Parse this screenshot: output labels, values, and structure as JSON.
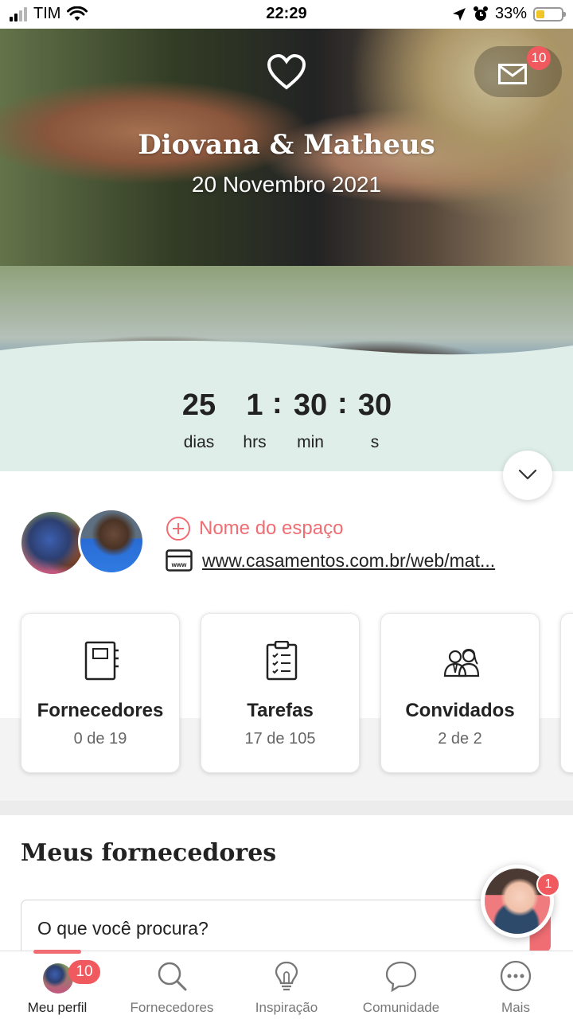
{
  "status_bar": {
    "carrier": "TIM",
    "time": "22:29",
    "battery_percent": "33%",
    "battery_level": 0.33
  },
  "hero": {
    "couple_names": "Diovana & Matheus",
    "wedding_date": "20 Novembro 2021",
    "messages_badge": "10",
    "countdown": {
      "days": "25",
      "days_label": "dias",
      "hours": "1",
      "hours_label": "hrs",
      "minutes": "30",
      "minutes_label": "min",
      "seconds": "30",
      "seconds_label": "s",
      "separator": ":"
    }
  },
  "couple_info": {
    "add_space_label": "Nome do espaço",
    "website_url": "www.casamentos.com.br/web/mat..."
  },
  "cards": [
    {
      "title": "Fornecedores",
      "subtitle": "0 de 19",
      "icon": "notebook-icon"
    },
    {
      "title": "Tarefas",
      "subtitle": "17 de 105",
      "icon": "clipboard-checklist-icon"
    },
    {
      "title": "Convidados",
      "subtitle": "2 de 2",
      "icon": "guests-icon"
    }
  ],
  "vendors_section": {
    "title": "Meus fornecedores",
    "search_placeholder": "O que você procura?"
  },
  "helper": {
    "badge": "1"
  },
  "bottom_nav": {
    "items": [
      {
        "label": "Meu perfil",
        "active": true,
        "badge": "10"
      },
      {
        "label": "Fornecedores",
        "active": false
      },
      {
        "label": "Inspiração",
        "active": false
      },
      {
        "label": "Comunidade",
        "active": false
      },
      {
        "label": "Mais",
        "active": false
      }
    ]
  },
  "colors": {
    "accent": "#ef6d73",
    "badge": "#f05a5f",
    "mint": "#dfeee9",
    "text": "#222222"
  }
}
